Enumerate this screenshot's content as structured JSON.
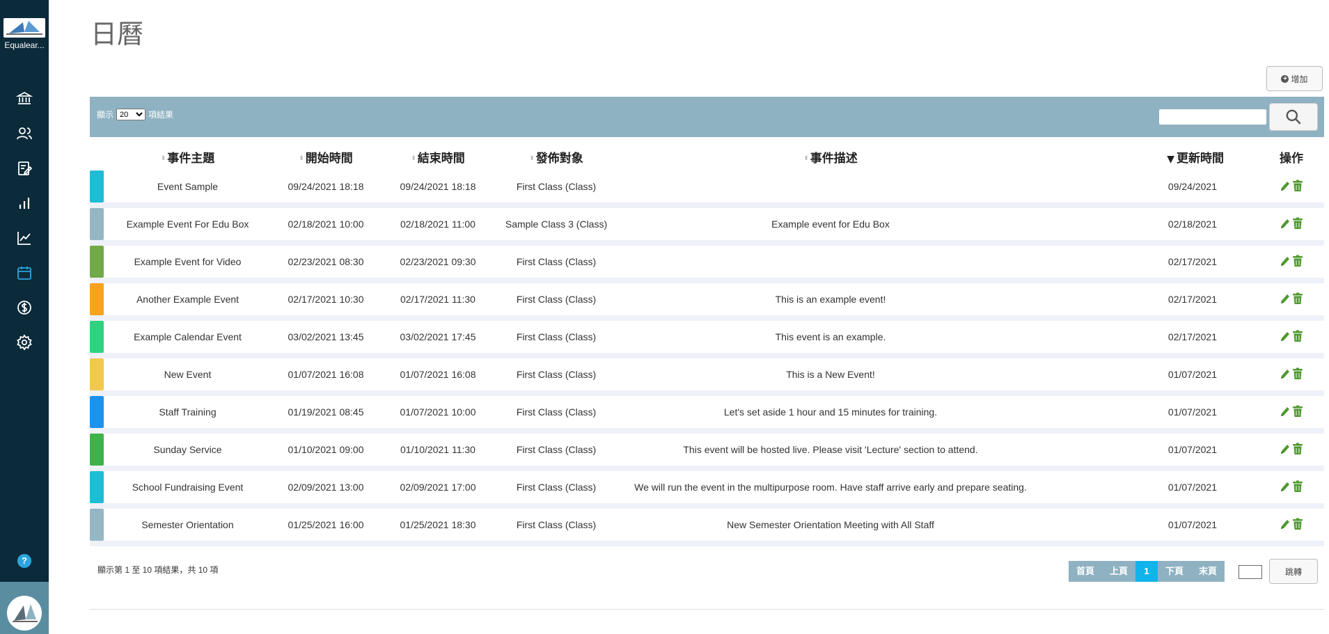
{
  "app": {
    "logo_text": "Equalear..."
  },
  "page": {
    "title": "日曆"
  },
  "toolbar": {
    "add_label": "增加",
    "show_prefix": "顯示",
    "page_size": "20",
    "show_suffix": "項結果",
    "search_placeholder": ""
  },
  "table": {
    "headers": [
      "事件主題",
      "開始時間",
      "結束時間",
      "發佈對象",
      "事件描述",
      "更新時間",
      "操作"
    ],
    "rows": [
      {
        "color": "#1fbcd6",
        "subject": "Event Sample",
        "start": "09/24/2021 18:18",
        "end": "09/24/2021 18:18",
        "target": "First Class (Class)",
        "description": "",
        "updated": "09/24/2021"
      },
      {
        "color": "#95b6c5",
        "subject": "Example Event For Edu Box",
        "start": "02/18/2021 10:00",
        "end": "02/18/2021 11:00",
        "target": "Sample Class 3 (Class)",
        "description": "Example event for Edu Box",
        "updated": "02/18/2021"
      },
      {
        "color": "#71ab48",
        "subject": "Example Event for Video",
        "start": "02/23/2021 08:30",
        "end": "02/23/2021 09:30",
        "target": "First Class (Class)",
        "description": "",
        "updated": "02/17/2021"
      },
      {
        "color": "#faa21d",
        "subject": "Another Example Event",
        "start": "02/17/2021 10:30",
        "end": "02/17/2021 11:30",
        "target": "First Class (Class)",
        "description": "This is an example event!",
        "updated": "02/17/2021"
      },
      {
        "color": "#2fd27e",
        "subject": "Example Calendar Event",
        "start": "03/02/2021 13:45",
        "end": "03/02/2021 17:45",
        "target": "First Class (Class)",
        "description": "This event is an example.",
        "updated": "02/17/2021"
      },
      {
        "color": "#f2c94c",
        "subject": "New Event",
        "start": "01/07/2021 16:08",
        "end": "01/07/2021 16:08",
        "target": "First Class (Class)",
        "description": "This is a New Event!",
        "updated": "01/07/2021"
      },
      {
        "color": "#1b92ec",
        "subject": "Staff Training",
        "start": "01/19/2021 08:45",
        "end": "01/07/2021 10:00",
        "target": "First Class (Class)",
        "description": "Let's set aside 1 hour and 15 minutes for training.",
        "updated": "01/07/2021"
      },
      {
        "color": "#3db34a",
        "subject": "Sunday Service",
        "start": "01/10/2021 09:00",
        "end": "01/10/2021 11:30",
        "target": "First Class (Class)",
        "description": "This event will be hosted live. Please visit 'Lecture' section to attend.",
        "updated": "01/07/2021"
      },
      {
        "color": "#1fbcd6",
        "subject": "School Fundraising Event",
        "start": "02/09/2021 13:00",
        "end": "02/09/2021 17:00",
        "target": "First Class (Class)",
        "description": "We will run the event in the multipurpose room. Have staff arrive early and prepare seating.",
        "updated": "01/07/2021"
      },
      {
        "color": "#95b6c5",
        "subject": "Semester Orientation",
        "start": "01/25/2021 16:00",
        "end": "01/25/2021 18:30",
        "target": "First Class (Class)",
        "description": "New Semester Orientation Meeting with All Staff",
        "updated": "01/07/2021"
      }
    ]
  },
  "footer": {
    "info": "顯示第 1 至 10 項結果，共 10 項",
    "pager": [
      "首頁",
      "上頁",
      "1",
      "下頁",
      "末頁"
    ],
    "jump_label": "跳轉"
  },
  "help": {
    "label": "?"
  },
  "colors": {
    "sidebar": "#0b2a3a",
    "toolbar": "#8fb2c2",
    "active_page": "#11b3ea",
    "action_green": "#4e9a2e"
  }
}
